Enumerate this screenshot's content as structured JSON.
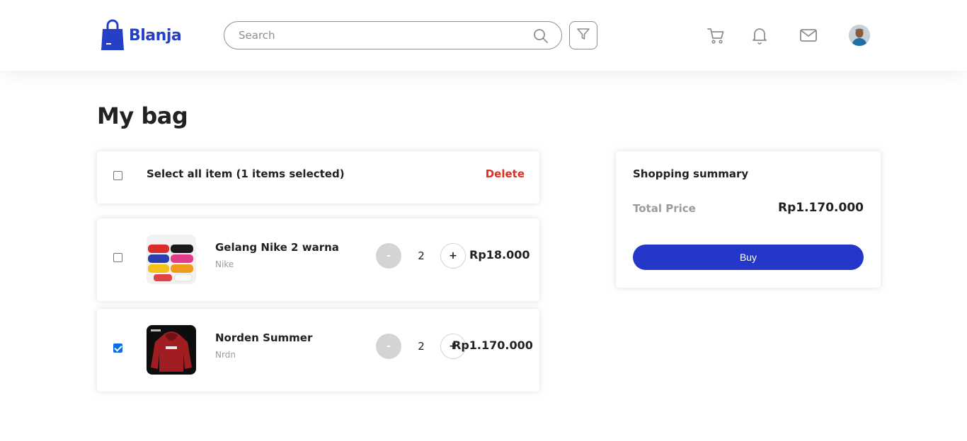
{
  "navbar": {
    "logo_text": "Blanja",
    "search_placeholder": "Search",
    "icons": [
      "shopping-bag-icon",
      "search-icon",
      "filter-icon",
      "cart-icon",
      "bell-icon",
      "mail-icon",
      "avatar"
    ]
  },
  "page": {
    "title": "My bag"
  },
  "selection": {
    "label": "Select all item (1 items selected)",
    "delete_label": "Delete",
    "all_checked": false
  },
  "items": [
    {
      "name": "Gelang Nike 2 warna",
      "brand": "Nike",
      "quantity": "2",
      "minus_label": "-",
      "plus_label": "+",
      "price": "Rp18.000",
      "checked": false
    },
    {
      "name": "Norden Summer",
      "brand": "Nrdn",
      "quantity": "2",
      "minus_label": "-",
      "plus_label": "+",
      "price": "Rp1.170.000",
      "checked": true
    }
  ],
  "summary": {
    "title": "Shopping summary",
    "total_label": "Total Price",
    "total_value": "Rp1.170.000",
    "buy_label": "Buy"
  },
  "colors": {
    "brand": "#2540c4",
    "buy_button": "#2437c8",
    "delete": "#db3022",
    "muted": "#9b9b9b",
    "checkbox_checked": "#0a6fe8"
  }
}
